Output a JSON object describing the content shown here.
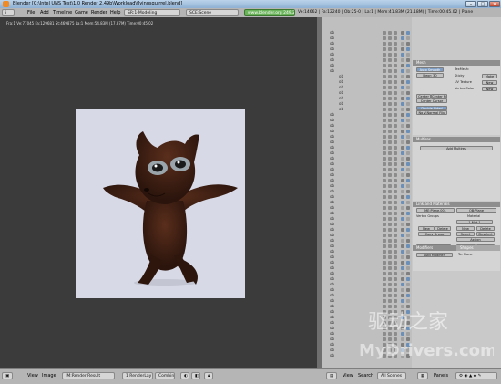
{
  "window": {
    "title": "Blender [C:\\Intel UNS Test\\1.0 Render 2.49b\\Workload\\flyingsquirrel.blend]",
    "controls": [
      "–",
      "□",
      "✕"
    ]
  },
  "header": {
    "menus": [
      "File",
      "Add",
      "Timeline",
      "Game",
      "Render",
      "Help"
    ],
    "screen_select": "SR:1-Modeling",
    "scene_select": "SCE:Scene",
    "url": "www.blender.org 249.2",
    "stats": "Ve:14662 | Fa:12240 | Ob:25-0 | La:1 | Mem:41.83M (21.18M) | Time:00:45.02 | Plane"
  },
  "render": {
    "info": "Fra:1  Ve:77045  Fa:129681  St:469875  La:1 Mem:54.83M (17.87M) Time:00:45.02"
  },
  "outliner": {
    "rows": [
      "ob",
      "ob",
      "ob",
      "ob",
      "ob",
      "ob",
      "ob",
      "ob",
      "ob",
      "ob",
      "ob",
      "ob",
      "ob",
      "ob",
      "ob",
      "ob",
      "ob",
      "ob",
      "ob",
      "ob",
      "ob",
      "ob",
      "ob",
      "ob",
      "ob",
      "ob",
      "ob",
      "ob",
      "ob",
      "ob",
      "ob",
      "ob",
      "ob",
      "ob",
      "ob",
      "ob",
      "ob",
      "ob",
      "ob",
      "ob",
      "ob",
      "ob",
      "ob",
      "ob",
      "ob",
      "ob",
      "ob",
      "ob",
      "ob",
      "ob",
      "ob",
      "ob",
      "ob",
      "ob",
      "ob",
      "ob",
      "ob",
      "ob",
      "ob",
      "ob"
    ]
  },
  "buttons": {
    "mesh_panel": {
      "title": "Mesh",
      "auto_smooth": "Auto Smooth",
      "degr": "Degr: 30",
      "texmesh": "TexMesh:",
      "sticky": "Sticky",
      "uv_texture": "UV Texture",
      "vertex_color": "Vertex Color",
      "make": "Make",
      "new1": "New",
      "new2": "New",
      "center": "Center",
      "center_new": "Center New",
      "center_cursor": "Center Cursor",
      "double_sided": "Double Sided",
      "no_v_normal_flip": "No V.Normal Flip"
    },
    "multires_panel": {
      "title": "Multires",
      "add_multires": "Add Multires"
    },
    "link_panel": {
      "title": "Link and Materials",
      "me_field": "ME:Plane.001",
      "ob_field": "OB:Plane",
      "vertex_groups": "Vertex Groups",
      "material": "Material",
      "mat_index": "1 Mat 1",
      "new_vg": "New",
      "delete_vg": "Delete",
      "new_mat": "New",
      "delete_mat": "Delete",
      "copy_group": "Copy Group",
      "select": "Select",
      "deselect": "Deselect",
      "assign": "Assign",
      "autotexspace": "AutoTexSpace",
      "set_smooth": "Set Smooth",
      "set_solid": "Set Solid"
    },
    "modifiers_panel": {
      "tab_modifiers": "Modifiers",
      "tab_shapes": "Shapes",
      "add_modifier": "Add Modifier",
      "to": "To: Plane"
    }
  },
  "bottom": {
    "view": "View",
    "image": "Image",
    "render_result": "IM:Render Result",
    "render_layer": "1 RenderLay",
    "combined": "Combin",
    "view2": "View",
    "search": "Search",
    "all_scenes": "All Scenes",
    "panels": "Panels"
  },
  "watermark": {
    "text1": "驱动之家",
    "text2": "MyDrivers.com"
  },
  "colors": {
    "squirrel_fur": "#3a1c12",
    "render_bg": "#d7d9e6",
    "url_green": "#6bb45b"
  }
}
